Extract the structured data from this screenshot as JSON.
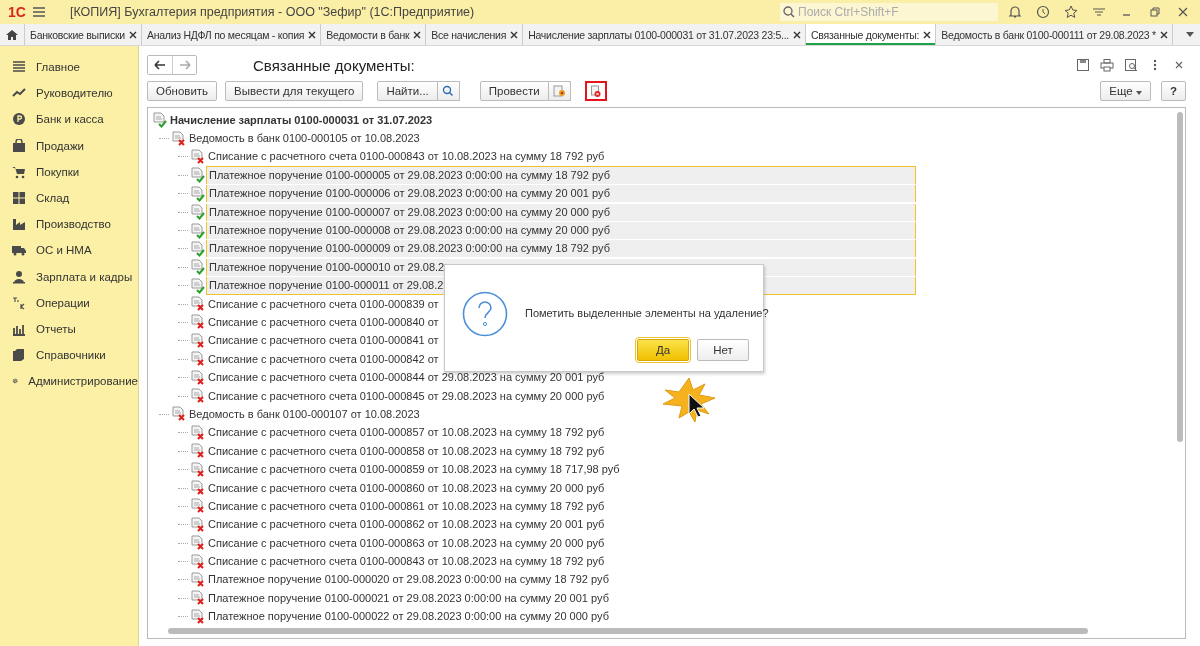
{
  "app_bar": {
    "logo": "1С",
    "title": "[КОПИЯ] Бухгалтерия предприятия - ООО \"Зефир\"  (1С:Предприятие)",
    "search": {
      "placeholder": "Поиск Ctrl+Shift+F"
    }
  },
  "tabs": [
    {
      "label": "Банковские выписки",
      "selected": false
    },
    {
      "label": "Анализ НДФЛ по месяцам - копия",
      "selected": false
    },
    {
      "label": "Ведомости в банк",
      "selected": false
    },
    {
      "label": "Все начисления",
      "selected": false
    },
    {
      "label": "Начисление зарплаты 0100-000031 от 31.07.2023 23:5...",
      "selected": false
    },
    {
      "label": "Связанные документы:",
      "selected": true
    },
    {
      "label": "Ведомость в банк 0100-000111 от 29.08.2023 *",
      "selected": false
    }
  ],
  "sidebar": {
    "items": [
      {
        "label": "Главное",
        "kind": "main"
      },
      {
        "label": "Руководителю",
        "kind": "chart"
      },
      {
        "label": "Банк и касса",
        "kind": "coin"
      },
      {
        "label": "Продажи",
        "kind": "bag"
      },
      {
        "label": "Покупки",
        "kind": "cart"
      },
      {
        "label": "Склад",
        "kind": "grid"
      },
      {
        "label": "Производство",
        "kind": "factory"
      },
      {
        "label": "ОС и НМА",
        "kind": "truck"
      },
      {
        "label": "Зарплата и кадры",
        "kind": "person"
      },
      {
        "label": "Операции",
        "kind": "dtkt"
      },
      {
        "label": "Отчеты",
        "kind": "bars"
      },
      {
        "label": "Справочники",
        "kind": "books"
      },
      {
        "label": "Администрирование",
        "kind": "gear"
      }
    ]
  },
  "form": {
    "title": "Связанные документы:",
    "toolbar": [
      {
        "label": "Обновить",
        "kind": "plain"
      },
      {
        "label": "Вывести для текущего",
        "kind": "plain"
      },
      {
        "label": "Найти...",
        "kind": "search"
      },
      {
        "label": "Провести",
        "kind": "post"
      }
    ],
    "more_button": "Еще",
    "help_button": "?",
    "tree": [
      {
        "label": "Начисление зарплаты 0100-000031 от 31.07.2023",
        "posted": true,
        "selected": false,
        "children": [
          {
            "label": "Ведомость в банк 0100-000105 от 10.08.2023",
            "posted": false,
            "selected": false,
            "children": [
              {
                "label": "Списание с расчетного счета 0100-000843 от 10.08.2023 на сумму 18 792 руб",
                "posted": false,
                "selected": false
              },
              {
                "label": "Платежное поручение 0100-000005 от 29.08.2023 0:00:00 на сумму 18 792 руб",
                "posted": true,
                "selected": true
              },
              {
                "label": "Платежное поручение 0100-000006 от 29.08.2023 0:00:00 на сумму 20 001 руб",
                "posted": true,
                "selected": true
              },
              {
                "label": "Платежное поручение 0100-000007 от 29.08.2023 0:00:00 на сумму 20 000 руб",
                "posted": true,
                "selected": true
              },
              {
                "label": "Платежное поручение 0100-000008 от 29.08.2023 0:00:00 на сумму 20 000 руб",
                "posted": true,
                "selected": true
              },
              {
                "label": "Платежное поручение 0100-000009 от 29.08.2023 0:00:00 на сумму 18 792 руб",
                "posted": true,
                "selected": true
              },
              {
                "label": "Платежное поручение 0100-000010 от 29.08.2",
                "posted": true,
                "selected": true
              },
              {
                "label": "Платежное поручение 0100-000011 от 29.08.2",
                "posted": true,
                "selected": true
              },
              {
                "label": "Списание с расчетного счета 0100-000839 от",
                "posted": false,
                "selected": false
              },
              {
                "label": "Списание с расчетного счета 0100-000840 от",
                "posted": false,
                "selected": false
              },
              {
                "label": "Списание с расчетного счета 0100-000841 от",
                "posted": false,
                "selected": false
              },
              {
                "label": "Списание с расчетного счета 0100-000842 от",
                "posted": false,
                "selected": false
              },
              {
                "label": "Списание с расчетного счета 0100-000844 от 29.08.2023 на сумму 20 001 руб",
                "posted": false,
                "selected": false
              },
              {
                "label": "Списание с расчетного счета 0100-000845 от 29.08.2023 на сумму 20 000 руб",
                "posted": false,
                "selected": false
              }
            ]
          },
          {
            "label": "Ведомость в банк 0100-000107 от 10.08.2023",
            "posted": false,
            "selected": false,
            "children": [
              {
                "label": "Списание с расчетного счета 0100-000857 от 10.08.2023 на сумму 18 792 руб",
                "posted": false,
                "selected": false
              },
              {
                "label": "Списание с расчетного счета 0100-000858 от 10.08.2023 на сумму 18 792 руб",
                "posted": false,
                "selected": false
              },
              {
                "label": "Списание с расчетного счета 0100-000859 от 10.08.2023 на сумму 18 717,98 руб",
                "posted": false,
                "selected": false
              },
              {
                "label": "Списание с расчетного счета 0100-000860 от 10.08.2023 на сумму 20 000 руб",
                "posted": false,
                "selected": false
              },
              {
                "label": "Списание с расчетного счета 0100-000861 от 10.08.2023 на сумму 18 792 руб",
                "posted": false,
                "selected": false
              },
              {
                "label": "Списание с расчетного счета 0100-000862 от 10.08.2023 на сумму 20 001 руб",
                "posted": false,
                "selected": false
              },
              {
                "label": "Списание с расчетного счета 0100-000863 от 10.08.2023 на сумму 20 000 руб",
                "posted": false,
                "selected": false
              },
              {
                "label": "Списание с расчетного счета 0100-000843 от 10.08.2023 на сумму 18 792 руб",
                "posted": false,
                "selected": false
              },
              {
                "label": "Платежное поручение 0100-000020 от 29.08.2023 0:00:00 на сумму 18 792 руб",
                "posted": false,
                "selected": false
              },
              {
                "label": "Платежное поручение 0100-000021 от 29.08.2023 0:00:00 на сумму 20 001 руб",
                "posted": false,
                "selected": false
              },
              {
                "label": "Платежное поручение 0100-000022 от 29.08.2023 0:00:00 на сумму 20 000 руб",
                "posted": false,
                "selected": false
              }
            ]
          }
        ]
      }
    ]
  },
  "dialog": {
    "message": "Пометить выделенные элементы на удаление?",
    "buttons": [
      {
        "label": "Да",
        "selected": true
      },
      {
        "label": "Нет",
        "selected": false
      }
    ]
  }
}
